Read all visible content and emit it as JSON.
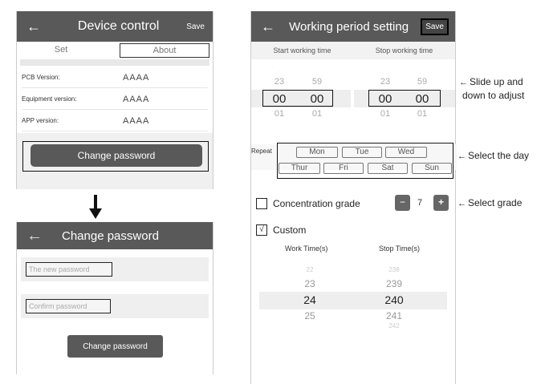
{
  "device_control": {
    "back": "←",
    "title": "Device control",
    "save": "Save",
    "tabs": [
      "Set",
      "About"
    ],
    "info": [
      {
        "label": "PCB Version:",
        "value": "AAAA"
      },
      {
        "label": "Equipment version:",
        "value": "AAAA"
      },
      {
        "label": "APP version:",
        "value": "AAAA"
      }
    ],
    "change_password_button": "Change password"
  },
  "change_password": {
    "back": "←",
    "title": "Change password",
    "new_password_placeholder": "The new password",
    "confirm_password_placeholder": "Confirm password",
    "submit_button": "Change password"
  },
  "working_period": {
    "back": "←",
    "title": "Working period setting",
    "save": "Save",
    "start_label": "Start working time",
    "stop_label": "Stop working time",
    "start_picker": {
      "hours": [
        "23",
        "00",
        "01"
      ],
      "minutes": [
        "59",
        "00",
        "01"
      ]
    },
    "stop_picker": {
      "hours": [
        "23",
        "00",
        "01"
      ],
      "minutes": [
        "59",
        "00",
        "01"
      ]
    },
    "repeat_label": "Repeat",
    "days": [
      "Mon",
      "Tue",
      "Wed",
      "Thur",
      "Fri",
      "Sat",
      "Sun"
    ],
    "concentration_label": "Concentration grade",
    "concentration_minus": "−",
    "concentration_value": "7",
    "concentration_plus": "+",
    "custom_check": "√",
    "custom_label": "Custom",
    "work_time_label": "Work Time(s)",
    "stop_time_label": "Stop Time(s)",
    "work_values": [
      "22",
      "23",
      "24",
      "25"
    ],
    "stop_values": [
      "238",
      "239",
      "240",
      "241",
      "242"
    ]
  },
  "callouts": {
    "slide_line1": "Slide up and",
    "slide_line2": "down to adjust",
    "select_day": "Select the day",
    "select_grade": "Select grade",
    "arrow": "←"
  },
  "colors": {
    "header": "#595959",
    "button": "#595959"
  }
}
